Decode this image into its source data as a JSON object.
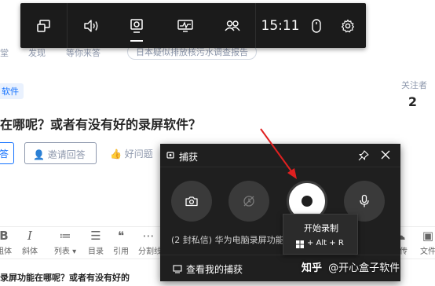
{
  "background_page": {
    "nav_items": [
      "堂",
      "发现",
      "等你来答",
      "日本疑似排放核污水调查报告"
    ],
    "tag": "软件",
    "question_title": "在哪呢？或者有没有好的录屏软件？",
    "follow_label": "关注者",
    "follow_count": "2",
    "answer_button": "答",
    "invite_button": "邀请回答",
    "good_question": "好问题",
    "toolbar": [
      {
        "icon": "B",
        "label": "粗体"
      },
      {
        "icon": "I",
        "label": "斜体"
      },
      {
        "icon": "≔",
        "label": "列表 ▾"
      },
      {
        "icon": "☰",
        "label": "目录"
      },
      {
        "icon": "❝",
        "label": "引用"
      },
      {
        "icon": "⋯",
        "label": "分割线"
      },
      {
        "icon": "☁",
        "label": "上传"
      },
      {
        "icon": "▣",
        "label": "文件"
      }
    ],
    "bottom_text": "录屏功能在哪呢？或者有没有好的"
  },
  "game_bar": {
    "buttons": [
      {
        "name": "widget-menu-button",
        "icon": "widget-menu-icon"
      },
      {
        "name": "audio-button",
        "icon": "speaker-icon"
      },
      {
        "name": "capture-button",
        "icon": "webcam-icon"
      },
      {
        "name": "performance-button",
        "icon": "monitor-graph-icon"
      },
      {
        "name": "social-button",
        "icon": "people-icon"
      }
    ],
    "clock": "15:11",
    "mouse_icon": "mouse-icon",
    "settings_icon": "gear-icon"
  },
  "capture_widget": {
    "title": "捕获",
    "pin_icon": "pin-icon",
    "close_icon": "close-icon",
    "screenshot_icon": "camera-icon",
    "record_last_icon": "record-last-disabled-icon",
    "start_recording_icon": "record-dot-icon",
    "mic_icon": "microphone-icon",
    "notification_text": "(2 封私信) 华为电脑录屏功能在哪呢？或者有...",
    "show_captures_link": "查看我的捕获"
  },
  "tooltip": {
    "title": "开始录制",
    "shortcut": "+ Alt + R"
  },
  "watermark": {
    "brand": "知乎",
    "author": "@开心盒子软件"
  },
  "colors": {
    "gamebar_bg": "#1b1b1b",
    "widget_bg": "#1f1f1f",
    "arrow": "#e02020",
    "zhihu_blue": "#0066ff"
  }
}
